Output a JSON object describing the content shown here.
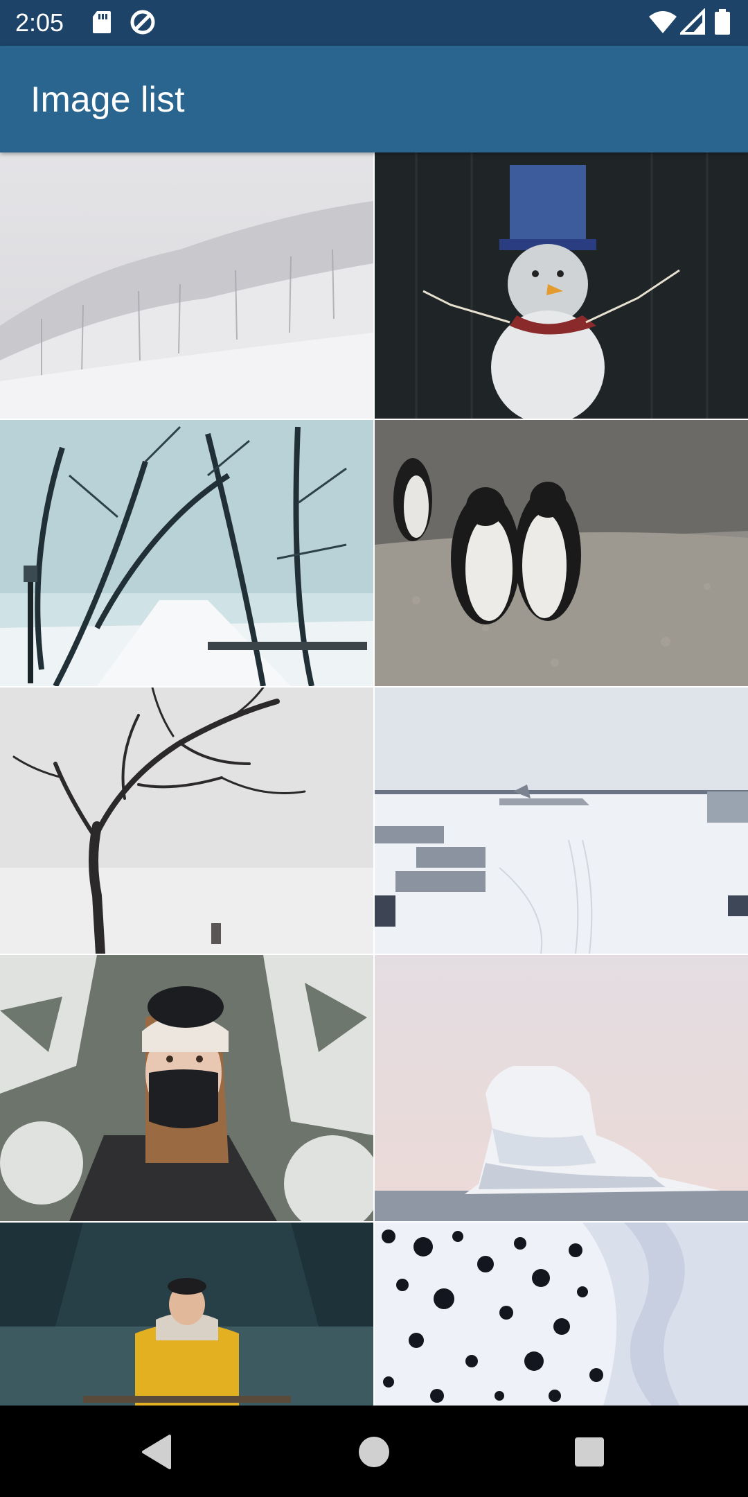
{
  "status_bar": {
    "time": "2:05",
    "icons": [
      "sd-card-icon",
      "data-saver-icon",
      "wifi-icon",
      "signal-icon",
      "battery-icon"
    ]
  },
  "app_bar": {
    "title": "Image list",
    "color": "#2a6590"
  },
  "images": [
    {
      "name": "snowy-forest-hillside-image"
    },
    {
      "name": "lit-snowman-decoration-image"
    },
    {
      "name": "snowy-park-path-image"
    },
    {
      "name": "penguins-image"
    },
    {
      "name": "bare-tree-in-snow-image"
    },
    {
      "name": "snowy-airport-image"
    },
    {
      "name": "woman-in-snow-goggles-image"
    },
    {
      "name": "iceberg-image"
    },
    {
      "name": "man-in-yellow-jacket-image"
    },
    {
      "name": "snow-with-dark-spots-image"
    }
  ],
  "nav_bar": {
    "buttons": [
      "back-button",
      "home-button",
      "recents-button"
    ]
  }
}
